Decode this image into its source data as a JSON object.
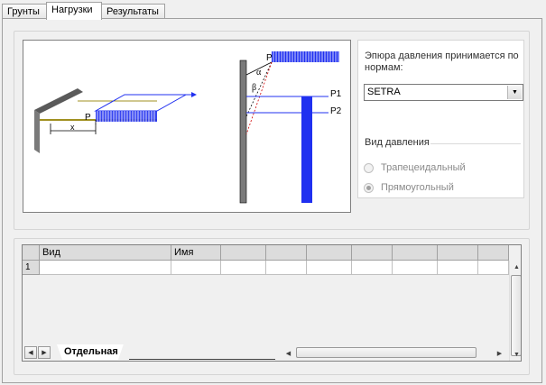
{
  "tabs": [
    {
      "label": "Грунты"
    },
    {
      "label": "Нагрузки"
    },
    {
      "label": "Результаты"
    }
  ],
  "diagram": {
    "dimension_x": "x",
    "load_P_left": "P",
    "load_P_top": "P",
    "angle_alpha": "α",
    "angle_beta": "β",
    "label_P1": "P1",
    "label_P2": "P2",
    "colors": {
      "load": "#2030f0",
      "wall": "#7a7a7a",
      "beam": "#a09020"
    }
  },
  "panel": {
    "pressure_label": "Эпюра давления принимается по нормам:",
    "norm_value": "SETRA",
    "pressure_type_label": "Вид давления",
    "radio_trapezoid": "Трапецеидальный",
    "radio_rect": "Прямоугольный"
  },
  "grid": {
    "columns": [
      "Вид",
      "Имя",
      "",
      "",
      "",
      "",
      "",
      "",
      "",
      ""
    ],
    "rows": [
      {
        "num": "1",
        "cells": [
          "",
          "",
          "",
          "",
          "",
          "",
          "",
          "",
          "",
          ""
        ]
      }
    ],
    "sheet_tab": "Отдельная"
  }
}
